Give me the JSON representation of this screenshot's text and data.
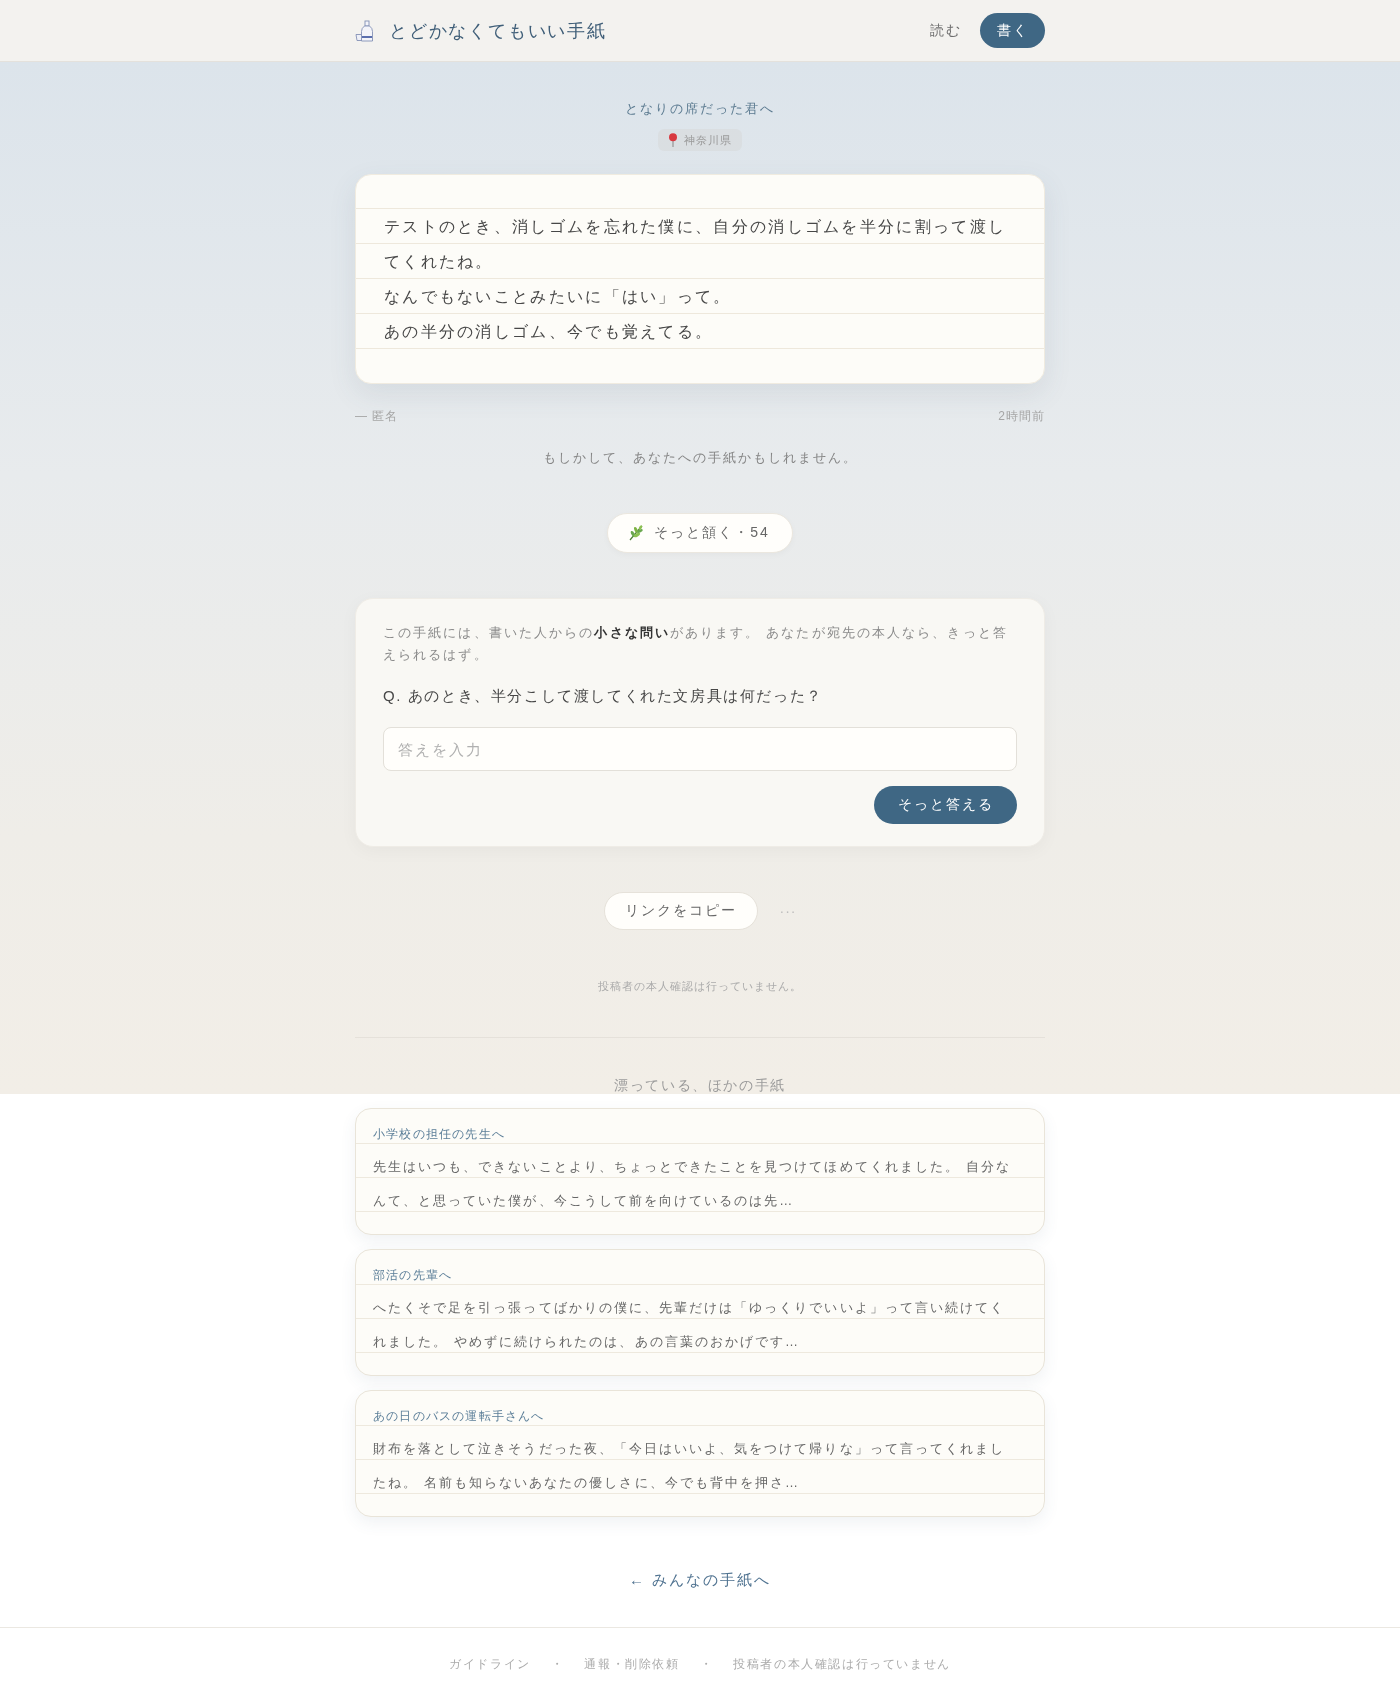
{
  "header": {
    "site_title": "とどかなくてもいい手紙",
    "nav": [
      {
        "label": "読む",
        "kind": "link"
      },
      {
        "label": "書く",
        "kind": "button"
      }
    ]
  },
  "letter": {
    "recipient": "となりの席だった君へ",
    "location": "神奈川県",
    "paragraphs": [
      "テストのとき、消しゴムを忘れた僕に、自分の消しゴムを半分に割って渡してくれたね。",
      "なんでもないことみたいに「はい」って。",
      "あの半分の消しゴム、今でも覚えてる。"
    ],
    "author": "— 匿名",
    "posted": "2時間前"
  },
  "hint": "もしかして、あなたへの手紙かもしれません。",
  "nod_button": {
    "label": "そっと頷く・54"
  },
  "question_card": {
    "intro": "この手紙には、書いた人からの**小さな問い**があります。 あなたが宛先の本人なら、きっと答えられるはず。",
    "question": "Q. あのとき、半分こして渡してくれた文房具は何だった？",
    "answer_field": {
      "placeholder": "答えを入力"
    },
    "submit_button": "そっと答える"
  },
  "share": {
    "copy_button": "リンクをコピー",
    "more_button": "···"
  },
  "notice": "投稿者の本人確認は行っていません。",
  "other_letters": {
    "heading": "漂っている、ほかの手紙",
    "items": [
      {
        "recipient": "小学校の担任の先生へ",
        "excerpt": "先生はいつも、できないことより、ちょっとできたことを見つけてほめてくれました。 自分なんて、と思っていた僕が、今こうして前を向けているのは先…"
      },
      {
        "recipient": "部活の先輩へ",
        "excerpt": "へたくそで足を引っ張ってばかりの僕に、先輩だけは「ゆっくりでいいよ」って言い続けてくれました。 やめずに続けられたのは、あの言葉のおかげです…"
      },
      {
        "recipient": "あの日のバスの運転手さんへ",
        "excerpt": "財布を落として泣きそうだった夜、「今日はいいよ、気をつけて帰りな」って言ってくれましたね。 名前も知らないあなたの優しさに、今でも背中を押さ…"
      }
    ]
  },
  "back_link": "← みんなの手紙へ",
  "footer": {
    "links": [
      "ガイドライン",
      "通報・削除依頼",
      "投稿者の本人確認は行っていません"
    ],
    "separators": [
      "・",
      "・"
    ]
  }
}
